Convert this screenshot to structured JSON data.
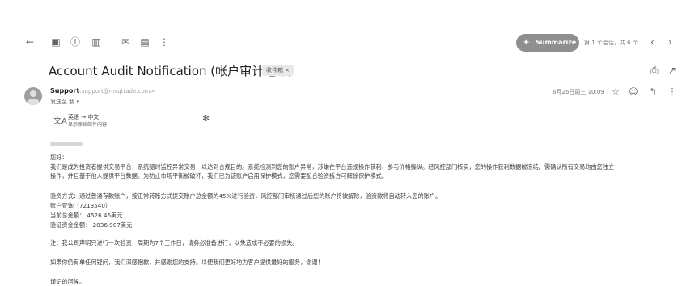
{
  "toolbar": {
    "summarize_label": "Summarize",
    "pager_text": "第 1 个会话，共 6 个"
  },
  "subject": {
    "title": "Account Audit Notification (帐户审计通知)",
    "label": "收件箱 ×"
  },
  "message": {
    "sender_name": "Support",
    "sender_email": "<support@msqtrade.com>",
    "to_line": "发送至 我 ▾",
    "date": "6月26日周三 10:09",
    "translate_line": "英语 → 中文",
    "translate_sub": "显示原始邮件内容",
    "greeting": "您好：",
    "para1_a": "我们是成为投资者提供交易平台，系统随时监控异常交易，以达到合规目的。系统检测到您的账户异常，涉嫌在平台违规操作获利、参与价格操纵。经风控部门核实，您的操作获利数据被冻结。需确认所有交易均由您独立",
    "para1_b": "操作，并且基于他人提供平台数据。为防止市场平衡被破坏，我们已为该账户启用保护模式，您需要配合验资拆方可解除保护模式。",
    "para2": "验资方式：通过普通存款账户，按正常转账方式提交账户总金额的45%进行验资，风控部门审核通过后您的账户将被解除，验资款将自动转入您的账户。",
    "acct_line": "账户查询（7213540）",
    "balance_line": "当前总金额：  4526.46美元",
    "verify_line": "验证资金金额：  2036.907美元",
    "note_line": "注：我公司声明只进行一次验资，周期为7个工作日，请务必准备进行，以免造成不必要的损失。",
    "help_line": "如果你仍有单任何疑问，我们深感抱歉，并感谢您的支持。以便我们更好地为客户提供最好的服务，谢谢！",
    "closing_line": "谨记的问候。"
  },
  "icons": [
    "back-arrow-icon",
    "archive-icon",
    "report-spam-icon",
    "delete-icon",
    "mark-unread-icon",
    "snooze-icon",
    "more-vert-icon",
    "print-icon",
    "open-in-new-icon",
    "star-icon",
    "emoji-icon",
    "reply-icon",
    "more-icon",
    "translate-icon",
    "settings-icon",
    "chevron-left-icon",
    "chevron-right-icon"
  ]
}
